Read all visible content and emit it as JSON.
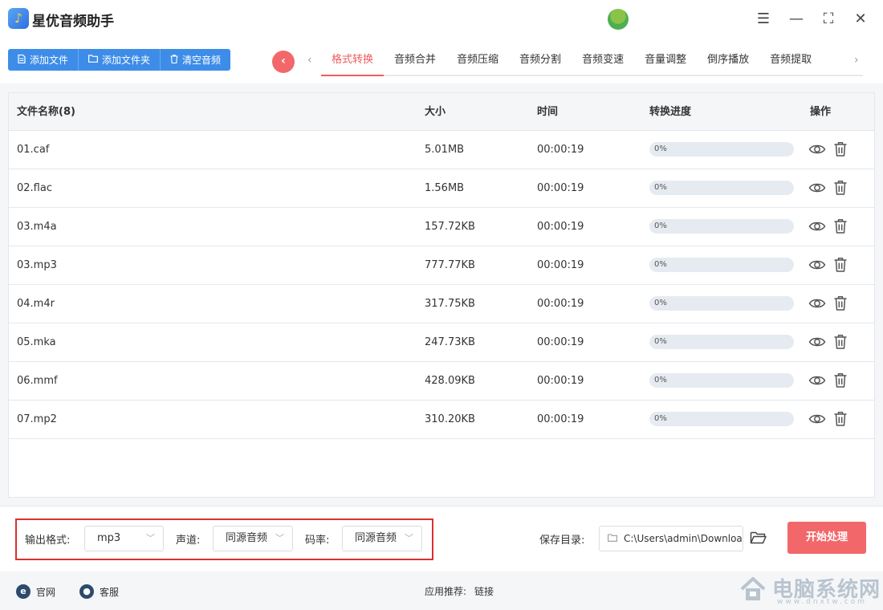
{
  "app": {
    "title": "星优音频助手",
    "logo_glyph": "♪"
  },
  "window_controls": {
    "settings": "☰",
    "minimize": "—",
    "maximize": "⛶",
    "close": "✕"
  },
  "toolbar": {
    "add_file": "添加文件",
    "add_folder": "添加文件夹",
    "clear_audio": "清空音频"
  },
  "nav": {
    "back_glyph": "‹",
    "prev_glyph": "‹",
    "next_glyph": "›"
  },
  "tabs": [
    "格式转换",
    "音频合并",
    "音频压缩",
    "音频分割",
    "音频变速",
    "音量调整",
    "倒序播放",
    "音频提取"
  ],
  "active_tab": "格式转换",
  "table": {
    "headers": {
      "name": "文件名称(8)",
      "size": "大小",
      "time": "时间",
      "progress": "转换进度",
      "action": "操作"
    },
    "rows": [
      {
        "name": "01.caf",
        "size": "5.01MB",
        "time": "00:00:19",
        "progress": "0%"
      },
      {
        "name": "02.flac",
        "size": "1.56MB",
        "time": "00:00:19",
        "progress": "0%"
      },
      {
        "name": "03.m4a",
        "size": "157.72KB",
        "time": "00:00:19",
        "progress": "0%"
      },
      {
        "name": "03.mp3",
        "size": "777.77KB",
        "time": "00:00:19",
        "progress": "0%"
      },
      {
        "name": "04.m4r",
        "size": "317.75KB",
        "time": "00:00:19",
        "progress": "0%"
      },
      {
        "name": "05.mka",
        "size": "247.73KB",
        "time": "00:00:19",
        "progress": "0%"
      },
      {
        "name": "06.mmf",
        "size": "428.09KB",
        "time": "00:00:19",
        "progress": "0%"
      },
      {
        "name": "07.mp2",
        "size": "310.20KB",
        "time": "00:00:19",
        "progress": "0%"
      }
    ]
  },
  "settings": {
    "format_label": "输出格式:",
    "format_value": "mp3",
    "channel_label": "声道:",
    "channel_value": "同源音频",
    "bitrate_label": "码率:",
    "bitrate_value": "同源音频",
    "save_label": "保存目录:",
    "save_path": "C:\\Users\\admin\\Downloads",
    "start_button": "开始处理"
  },
  "footer": {
    "official_site": "官网",
    "service": "客服",
    "recommend_label": "应用推荐:",
    "recommend_link": "链接"
  },
  "watermark": {
    "text": "电脑系统网",
    "sub": "www.dnxtw.com"
  },
  "colors": {
    "accent_blue": "#3d8de8",
    "accent_red": "#f2686a",
    "highlight_box": "#d9312f"
  }
}
